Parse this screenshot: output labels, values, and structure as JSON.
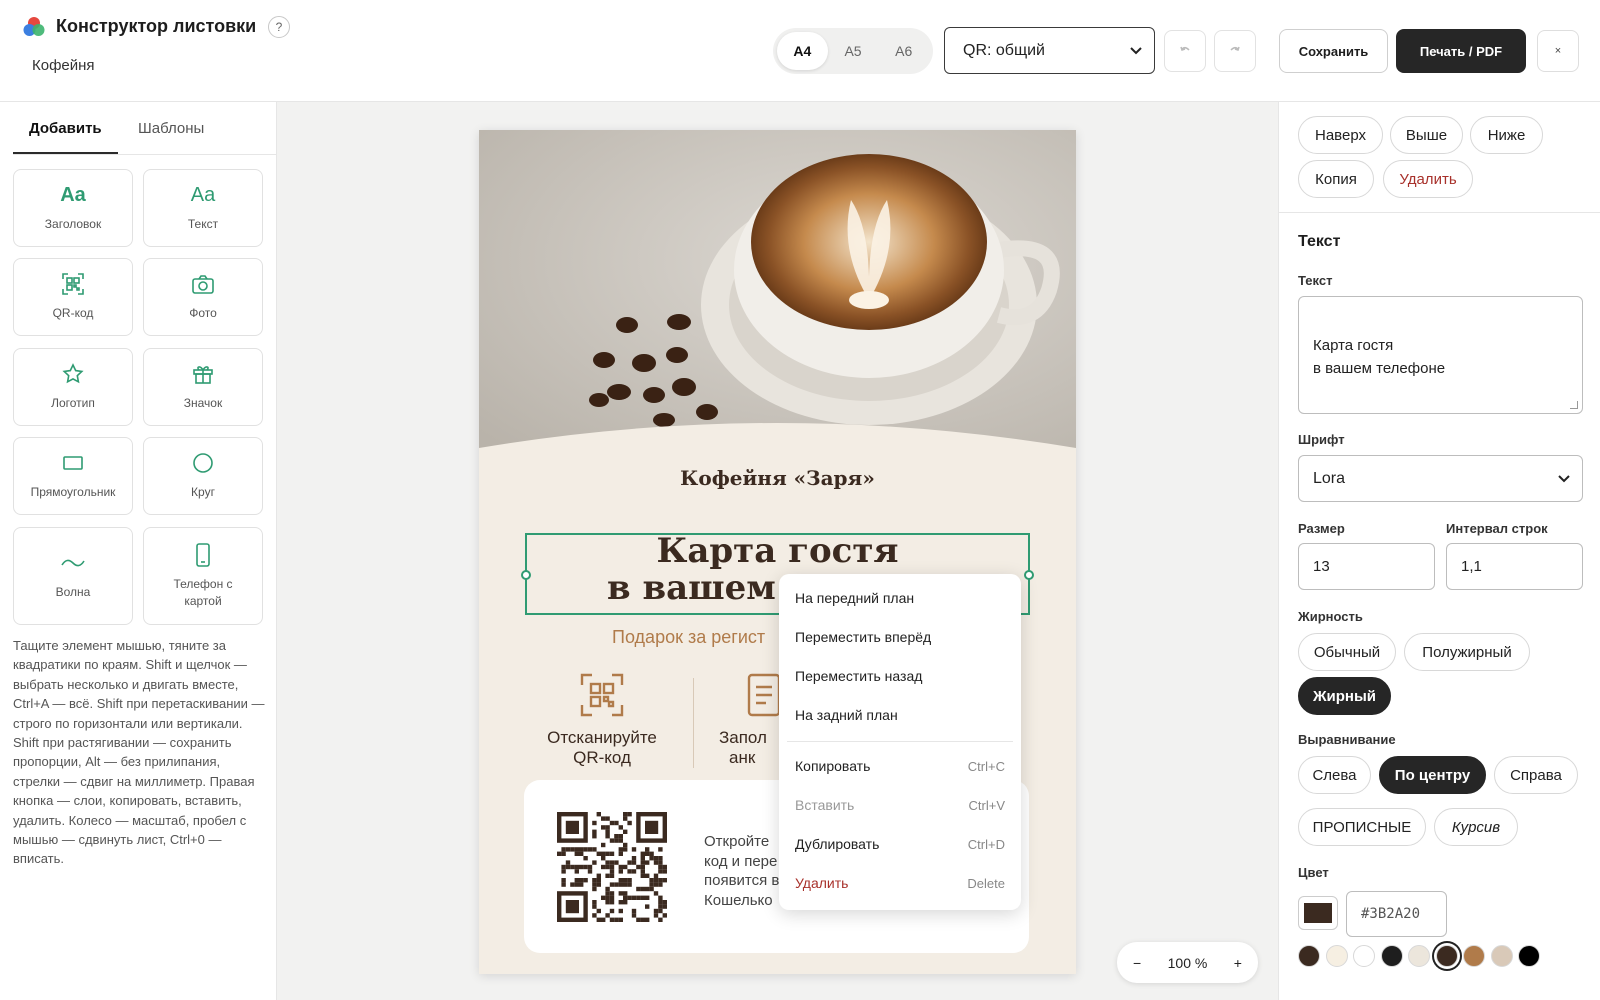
{
  "header": {
    "app_title": "Конструктор листовки",
    "help_label": "?",
    "project_name": "Кофейня",
    "formats": [
      "A4",
      "A5",
      "A6"
    ],
    "active_format": "A4",
    "qr_select_value": "QR: общий",
    "save_label": "Сохранить",
    "print_label": "Печать / PDF",
    "close_label": "×"
  },
  "left_panel": {
    "tabs": [
      {
        "label": "Добавить",
        "active": true
      },
      {
        "label": "Шаблоны",
        "active": false
      }
    ],
    "tiles": [
      {
        "label": "Заголовок",
        "icon": "heading-aa-icon",
        "glyph": "Aa"
      },
      {
        "label": "Текст",
        "icon": "text-aa-icon",
        "glyph": "Aa"
      },
      {
        "label": "QR-код",
        "icon": "qr-icon"
      },
      {
        "label": "Фото",
        "icon": "camera-icon"
      },
      {
        "label": "Логотип",
        "icon": "star-icon"
      },
      {
        "label": "Значок",
        "icon": "gift-icon"
      },
      {
        "label": "Прямоугольник",
        "icon": "rectangle-icon"
      },
      {
        "label": "Круг",
        "icon": "circle-icon"
      },
      {
        "label": "Волна",
        "icon": "wave-icon"
      },
      {
        "label": "Телефон с картой",
        "icon": "phone-icon"
      }
    ],
    "help_text": "Тащите элемент мышью, тяните за квадратики по краям. Shift и щелчок — выбрать несколько и двигать вместе, Ctrl+A — всё. Shift при перетаскивании — строго по горизонтали или вертикали. Shift при растягивании — сохранить пропорции, Alt — без прилипания, стрелки — сдвиг на миллиметр. Правая кнопка — слои, копировать, вставить, удалить. Колесо — масштаб, пробел с мышью — сдвинуть лист, Ctrl+0 — вписать."
  },
  "canvas": {
    "cafe_name": "Кофейня «Заря»",
    "headline_line1": "Карта гостя",
    "headline_line2": "в вашем т",
    "gift_text": "Подарок за регист",
    "step1_line1": "Отсканируйте",
    "step1_line2": "QR-код",
    "step2_line1": "Запол",
    "step2_line2": "анк",
    "qr_desc_lines": [
      "Откройте",
      "код и пере",
      "появится в",
      "Кошелько"
    ]
  },
  "context_menu": {
    "items": [
      {
        "label": "На передний план",
        "shortcut": "",
        "state": "normal"
      },
      {
        "label": "Переместить вперёд",
        "shortcut": "",
        "state": "normal"
      },
      {
        "label": "Переместить назад",
        "shortcut": "",
        "state": "normal"
      },
      {
        "label": "На задний план",
        "shortcut": "",
        "state": "normal"
      },
      {
        "label": "Копировать",
        "shortcut": "Ctrl+C",
        "state": "normal"
      },
      {
        "label": "Вставить",
        "shortcut": "Ctrl+V",
        "state": "disabled"
      },
      {
        "label": "Дублировать",
        "shortcut": "Ctrl+D",
        "state": "normal"
      },
      {
        "label": "Удалить",
        "shortcut": "Delete",
        "state": "danger"
      }
    ]
  },
  "zoom": {
    "minus": "−",
    "value": "100 %",
    "plus": "+"
  },
  "right_panel": {
    "layer_buttons": [
      "Наверх",
      "Выше",
      "Ниже",
      "Копия",
      "Удалить"
    ],
    "section_title": "Текст",
    "text_label": "Текст",
    "text_value": "Карта гостя\nв вашем телефоне",
    "font_label": "Шрифт",
    "font_value": "Lora",
    "size_label": "Размер",
    "size_value": "13",
    "line_spacing_label": "Интервал строк",
    "line_spacing_value": "1,1",
    "weight_label": "Жирность",
    "weights": [
      {
        "label": "Обычный",
        "active": false
      },
      {
        "label": "Полужирный",
        "active": false
      },
      {
        "label": "Жирный",
        "active": true
      }
    ],
    "align_label": "Выравнивание",
    "aligns": [
      {
        "label": "Слева",
        "active": false
      },
      {
        "label": "По центру",
        "active": true
      },
      {
        "label": "Справа",
        "active": false
      }
    ],
    "uppercase_label": "ПРОПИСНЫЕ",
    "italic_label": "Курсив",
    "color_label": "Цвет",
    "color_hex": "#3B2A20",
    "swatches": [
      "#3b2a20",
      "#f6efe2",
      "#ffffff",
      "#1e1e1e",
      "#ece6dc",
      "#3b2a20",
      "#b07b4a",
      "#d9c9b8",
      "#000000"
    ],
    "selected_swatch": 5
  },
  "colors": {
    "accent": "#2f9b72",
    "brand_dark": "#3b2a20",
    "danger": "#a8312b"
  }
}
